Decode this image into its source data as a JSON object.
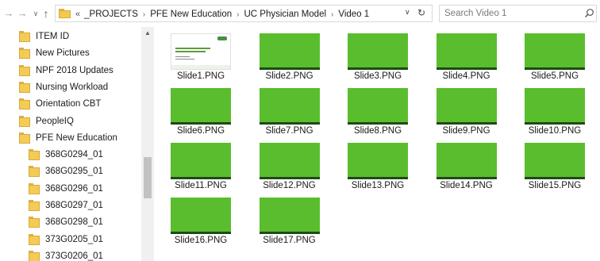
{
  "address_bar": {
    "lead": "«",
    "crumbs": [
      "_PROJECTS",
      "PFE New Education",
      "UC Physician Model",
      "Video 1"
    ]
  },
  "search": {
    "placeholder": "Search Video 1"
  },
  "nav_pane": {
    "items": [
      "ITEM ID",
      "New Pictures",
      "NPF 2018 Updates",
      "Nursing Workload",
      "Orientation CBT",
      "PeopleIQ",
      "PFE New Education",
      "368G0294_01",
      "368G0295_01",
      "368G0296_01",
      "368G0297_01",
      "368G0298_01",
      "373G0205_01",
      "373G0206_01"
    ]
  },
  "files": [
    "Slide1.PNG",
    "Slide2.PNG",
    "Slide3.PNG",
    "Slide4.PNG",
    "Slide5.PNG",
    "Slide6.PNG",
    "Slide7.PNG",
    "Slide8.PNG",
    "Slide9.PNG",
    "Slide10.PNG",
    "Slide11.PNG",
    "Slide12.PNG",
    "Slide13.PNG",
    "Slide14.PNG",
    "Slide15.PNG",
    "Slide16.PNG",
    "Slide17.PNG"
  ],
  "colors": {
    "slide_green": "#5abd2e",
    "folder_yellow": "#f4cb55"
  }
}
